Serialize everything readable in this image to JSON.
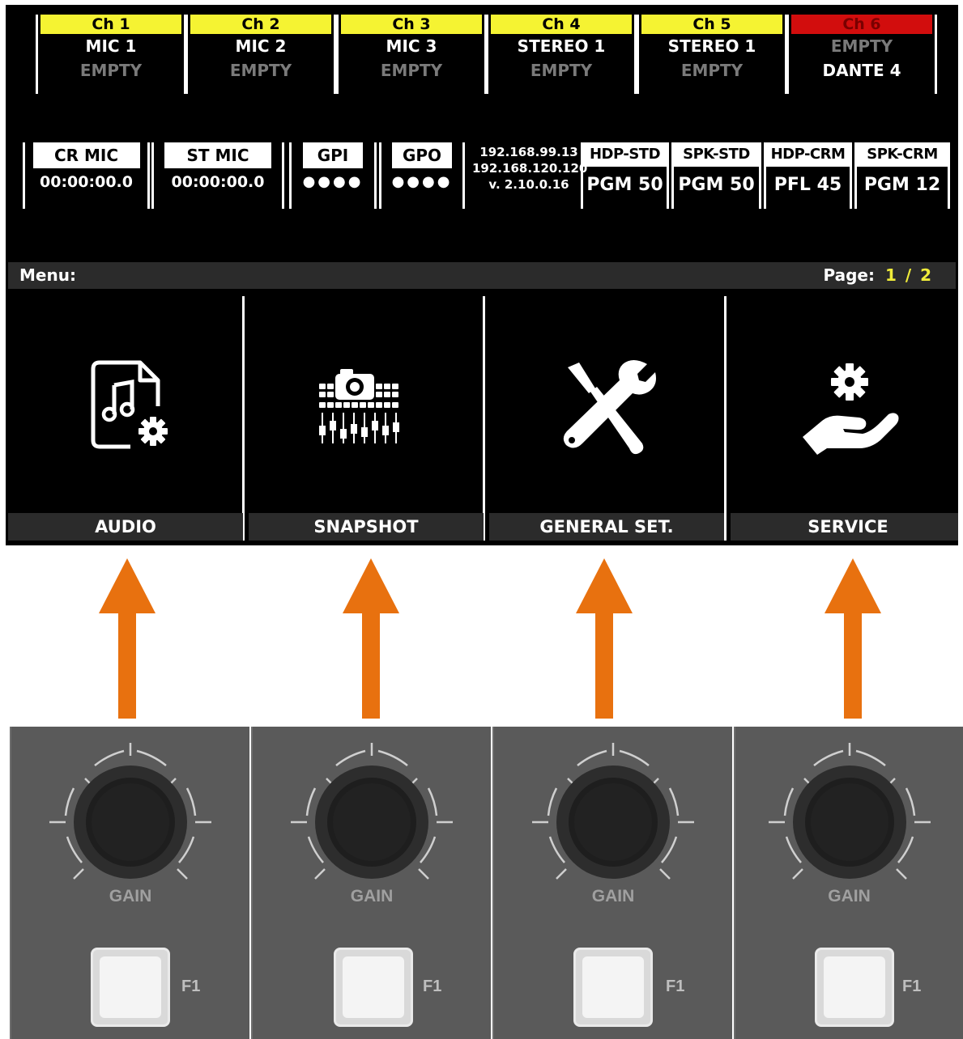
{
  "channels": [
    {
      "head": "Ch 1",
      "name": "MIC 1",
      "source": "EMPTY",
      "head_color": "#f5f332"
    },
    {
      "head": "Ch 2",
      "name": "MIC 2",
      "source": "EMPTY",
      "head_color": "#f5f332"
    },
    {
      "head": "Ch 3",
      "name": "MIC 3",
      "source": "EMPTY",
      "head_color": "#f5f332"
    },
    {
      "head": "Ch 4",
      "name": "STEREO 1",
      "source": "EMPTY",
      "head_color": "#f5f332"
    },
    {
      "head": "Ch 5",
      "name": "STEREO 1",
      "source": "EMPTY",
      "head_color": "#f5f332"
    },
    {
      "head": "Ch 6",
      "name": "EMPTY",
      "source": "DANTE 4",
      "head_color": "#d20d0d"
    }
  ],
  "status": {
    "cr_mic": {
      "label": "CR MIC",
      "value": "00:00:00.0"
    },
    "st_mic": {
      "label": "ST MIC",
      "value": "00:00:00.0"
    },
    "gpi": {
      "label": "GPI",
      "value": "●●●●"
    },
    "gpo": {
      "label": "GPO",
      "value": "●●●●"
    },
    "ip1": "192.168.99.13",
    "ip2": "192.168.120.120",
    "version": "v. 2.10.0.16"
  },
  "monitors": [
    {
      "label": "HDP-STD",
      "value": "PGM 50"
    },
    {
      "label": "SPK-STD",
      "value": "PGM 50"
    },
    {
      "label": "HDP-CRM",
      "value": "PFL 45"
    },
    {
      "label": "SPK-CRM",
      "value": "PGM 12"
    }
  ],
  "menu": {
    "label": "Menu:",
    "page_label": "Page:",
    "page_value": "1 / 2",
    "items": [
      {
        "label": "AUDIO",
        "icon": "audio-settings-icon"
      },
      {
        "label": "SNAPSHOT",
        "icon": "snapshot-icon"
      },
      {
        "label": "GENERAL SET.",
        "icon": "tools-icon"
      },
      {
        "label": "SERVICE",
        "icon": "service-icon"
      }
    ]
  },
  "strips": [
    {
      "gain_label": "GAIN",
      "button_label": "F1"
    },
    {
      "gain_label": "GAIN",
      "button_label": "F1"
    },
    {
      "gain_label": "GAIN",
      "button_label": "F1"
    },
    {
      "gain_label": "GAIN",
      "button_label": "F1"
    }
  ],
  "colors": {
    "arrow": "#e8710f",
    "accent_yellow": "#f0ec3a",
    "red": "#d20d0d"
  }
}
